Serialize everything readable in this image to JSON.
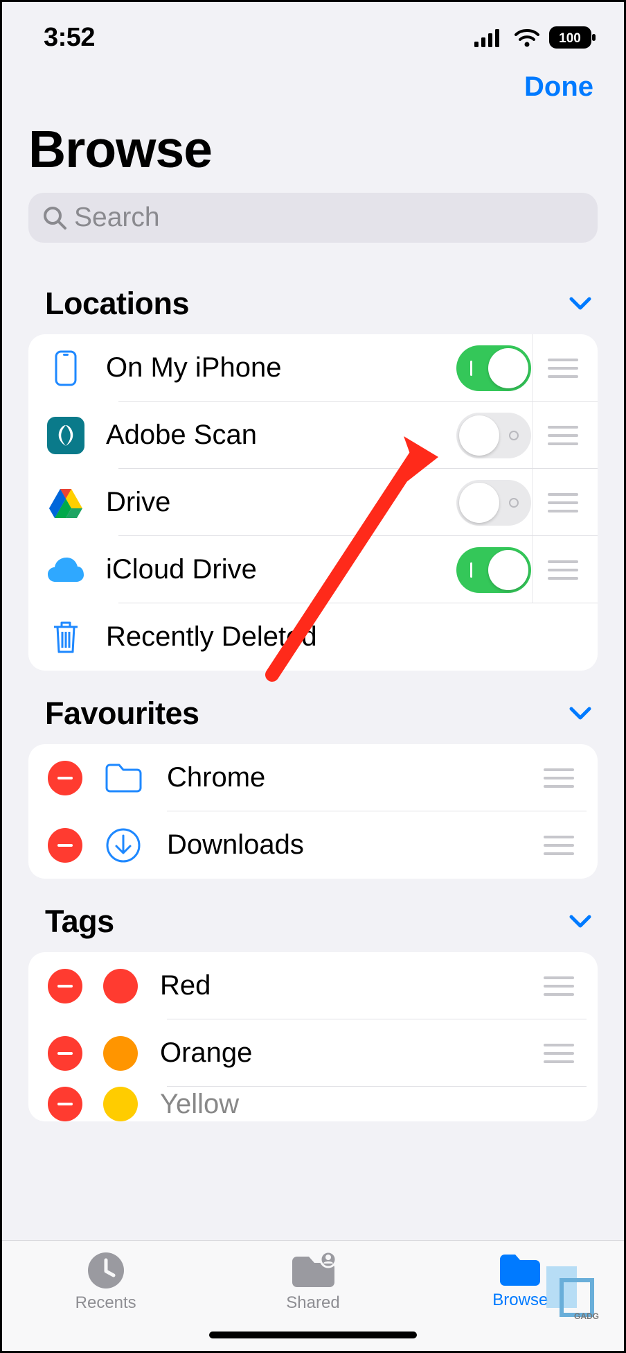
{
  "status": {
    "time": "3:52",
    "battery": "100"
  },
  "nav": {
    "done": "Done"
  },
  "title": "Browse",
  "search": {
    "placeholder": "Search"
  },
  "sections": {
    "locations": {
      "title": "Locations",
      "items": [
        {
          "label": "On My iPhone",
          "icon": "iphone",
          "enabled": true,
          "reorderable": true
        },
        {
          "label": "Adobe Scan",
          "icon": "adobe",
          "enabled": false,
          "reorderable": true
        },
        {
          "label": "Drive",
          "icon": "gdrive",
          "enabled": false,
          "reorderable": true
        },
        {
          "label": "iCloud Drive",
          "icon": "icloud",
          "enabled": true,
          "reorderable": true
        },
        {
          "label": "Recently Deleted",
          "icon": "trash",
          "enabled": null,
          "reorderable": false
        }
      ]
    },
    "favourites": {
      "title": "Favourites",
      "items": [
        {
          "label": "Chrome",
          "icon": "folder"
        },
        {
          "label": "Downloads",
          "icon": "download"
        }
      ]
    },
    "tags": {
      "title": "Tags",
      "items": [
        {
          "label": "Red",
          "color": "#ff3b30"
        },
        {
          "label": "Orange",
          "color": "#ff9500"
        },
        {
          "label": "Yellow",
          "color": "#ffcc00"
        }
      ]
    }
  },
  "tabbar": {
    "recents": "Recents",
    "shared": "Shared",
    "browse": "Browse"
  },
  "annotation": {
    "arrow_target": "Drive toggle"
  }
}
